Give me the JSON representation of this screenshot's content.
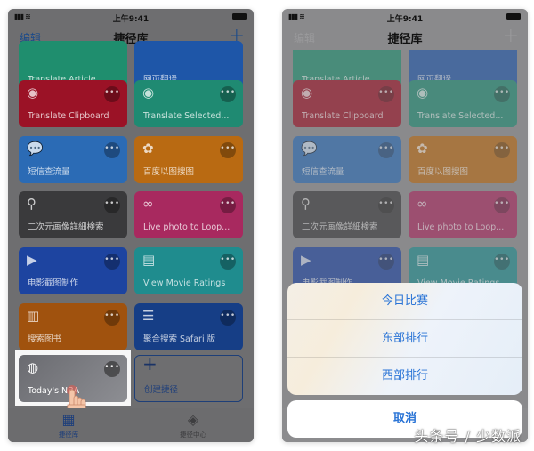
{
  "status_bar": {
    "time": "上午9:41",
    "signal": "▮▮▮ ᯤ"
  },
  "nav": {
    "edit_label": "编辑",
    "title": "捷径库",
    "add_label": "+"
  },
  "cards": [
    {
      "label": "Translate Article",
      "icon": "globe-icon",
      "color": "#1f8e6e"
    },
    {
      "label": "网页翻译",
      "icon": "globe-icon",
      "color": "#1e56a8"
    },
    {
      "label": "Translate Clipboard",
      "icon": "globe-icon",
      "color": "#9b1226"
    },
    {
      "label": "Translate Selected...",
      "icon": "globe-icon",
      "color": "#1f8a72"
    },
    {
      "label": "短信查流量",
      "icon": "chat-bubble-icon",
      "color": "#2b6bb5"
    },
    {
      "label": "百度以图搜图",
      "icon": "gear-icon",
      "color": "#b96a12"
    },
    {
      "label": "二次元画像詳細検索",
      "icon": "magnifier-icon",
      "color": "#3a3a3c"
    },
    {
      "label": "Live photo to Loop...",
      "icon": "infinity-icon",
      "color": "#a8295f"
    },
    {
      "label": "电影截图制作",
      "icon": "play-icon",
      "color": "#1d44a0"
    },
    {
      "label": "View Movie Ratings",
      "icon": "film-icon",
      "color": "#1f8c8e"
    },
    {
      "label": "搜索图书",
      "icon": "book-icon",
      "color": "#a0520e"
    },
    {
      "label": "聚合搜索 Safari 版",
      "icon": "list-icon",
      "color": "#163e86"
    }
  ],
  "highlighted_card": {
    "label": "Today's NBA",
    "icon": "basketball-icon"
  },
  "create_card": {
    "label": "创建捷径",
    "icon": "+"
  },
  "more_glyph": "•••",
  "tabs": [
    {
      "label": "捷径库",
      "icon": "grid-icon",
      "active": true
    },
    {
      "label": "捷径中心",
      "icon": "layers-icon",
      "active": false
    }
  ],
  "action_sheet": {
    "items": [
      "今日比赛",
      "东部排行",
      "西部排行"
    ],
    "cancel_label": "取消"
  },
  "watermark": "头条号 / 少数派"
}
